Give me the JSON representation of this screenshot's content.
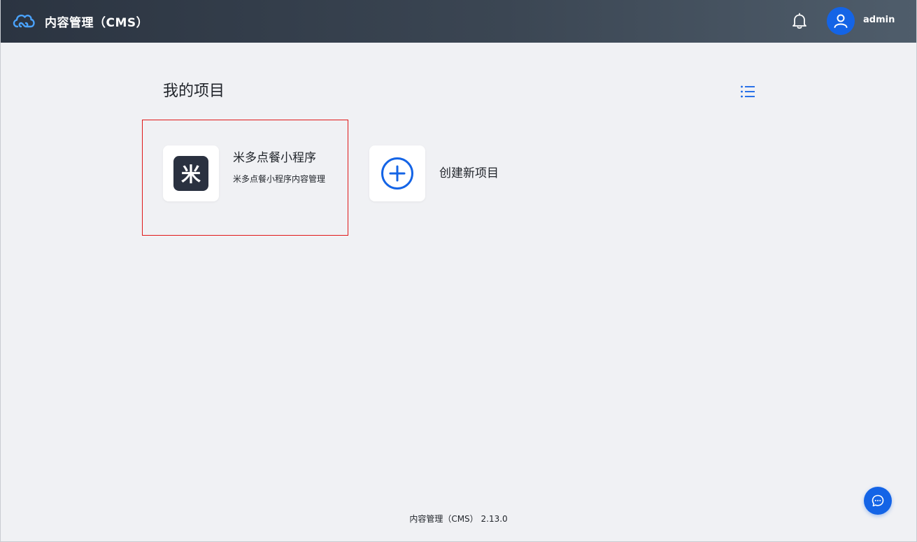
{
  "header": {
    "app_title": "内容管理（CMS）",
    "username": "admin",
    "logo_icon": "cloud-icon",
    "notification_icon": "bell-icon",
    "avatar_icon": "user-icon"
  },
  "main": {
    "section_title": "我的项目",
    "view_toggle_icon": "list-icon",
    "projects": [
      {
        "name": "米多点餐小程序",
        "description": "米多点餐小程序内容管理",
        "icon_glyph": "米"
      }
    ],
    "create_project": {
      "label": "创建新项目",
      "icon": "plus-circle-icon"
    }
  },
  "footer": {
    "text": "内容管理（CMS） 2.13.0"
  },
  "chat": {
    "icon": "chat-icon"
  },
  "colors": {
    "accent": "#1464e6",
    "header_dark": "#2b3441",
    "highlight_border": "#e01818",
    "project_icon_bg": "#2a3140"
  }
}
